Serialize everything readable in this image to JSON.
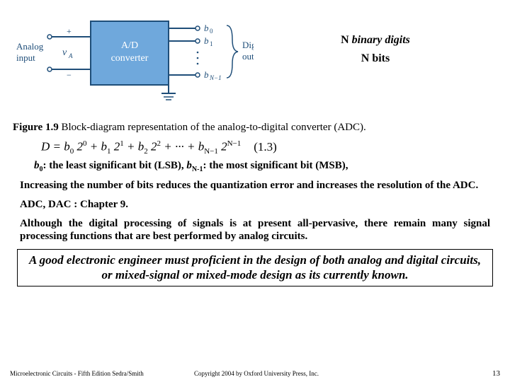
{
  "diagram": {
    "analog_label": "Analog",
    "input_label": "input",
    "vA_plus": "+",
    "vA": "v",
    "vA_sub": "A",
    "vA_minus": "−",
    "block": "A/D\nconverter",
    "b0": "b",
    "b0_sub": "0",
    "b1": "b",
    "b1_sub": "1",
    "bN1": "b",
    "bN1_sub": "N−1",
    "digital_label": "Digital",
    "output_label": "output"
  },
  "side": {
    "line1a": "N ",
    "line1b": "binary digits",
    "line2": "N bits"
  },
  "caption": {
    "fig": "Figure 1.9",
    "text": "  Block-diagram representation of the analog-to-digital converter (ADC)."
  },
  "equation": {
    "D": "D = b",
    "t0": " 2",
    "plus": " + b",
    "dots": " + ··· + b",
    "num": "(1.3)"
  },
  "bits": {
    "b0_pre": "b",
    "b0_sub": "0",
    "b0_txt": ": the least significant bit (LSB), ",
    "bN_pre": "b",
    "bN_sub": "N-1",
    "bN_txt": ": the most significant bit (MSB),"
  },
  "p1": "Increasing the number of bits reduces the quantization error and increases the resolution of the ADC.",
  "p2": "ADC, DAC : Chapter 9.",
  "p3": "Although the digital processing of signals is at present all-pervasive, there remain many signal processing functions that are best performed by analog circuits.",
  "box": "A good electronic engineer must proficient in the design of both analog and digital circuits, or mixed-signal or mixed-mode design as its currently known.",
  "footer": {
    "left": "Microelectronic Circuits - Fifth Edition    Sedra/Smith",
    "mid": "Copyright  2004 by Oxford University Press, Inc.",
    "page": "13"
  }
}
